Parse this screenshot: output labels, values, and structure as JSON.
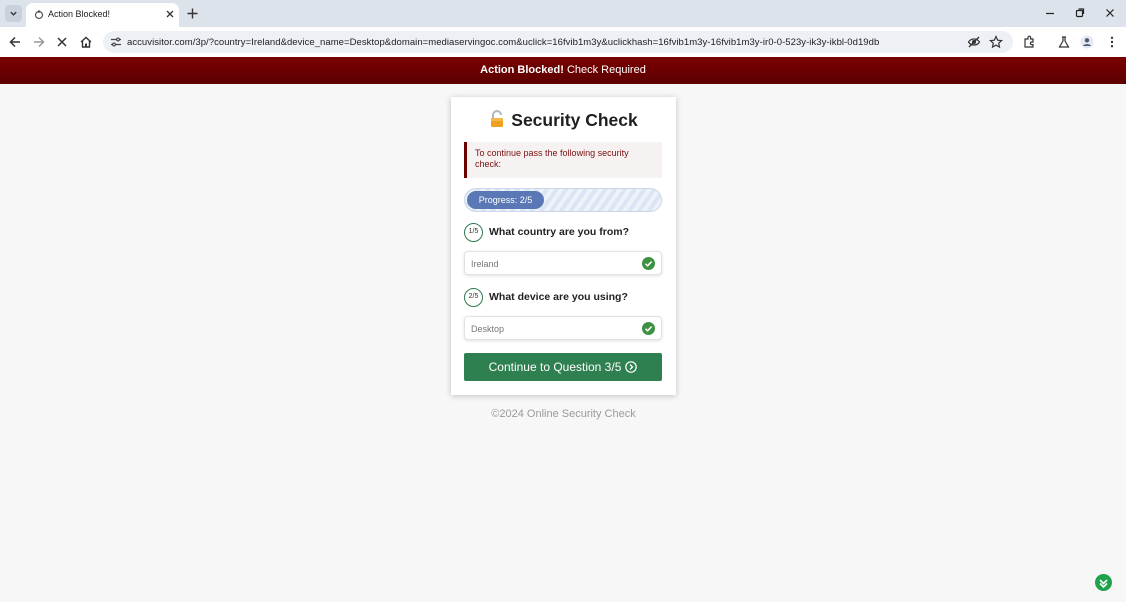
{
  "browser": {
    "tab_title": "Action Blocked!",
    "url_host": "accuvisitor.com",
    "url_rest": "/3p/?country=Ireland&device_name=Desktop&domain=mediaservingoc.com&uclick=16fvib1m3y&uclickhash=16fvib1m3y-16fvib1m3y-ir0-0-523y-ik3y-ikbl-0d19db"
  },
  "alert_bar": {
    "bold": "Action Blocked!",
    "text": " Check Required"
  },
  "card": {
    "title": "Security Check",
    "notice": "To continue pass the following security check:",
    "progress": {
      "label": "Progress: 2/5",
      "value": 0.4
    },
    "questions": [
      {
        "number": "1/5",
        "text": "What country are you from?",
        "answer": "Ireland"
      },
      {
        "number": "2/5",
        "text": "What device are you using?",
        "answer": "Desktop"
      }
    ],
    "continue_label": "Continue to Question 3/5"
  },
  "footer": "©2024 Online Security Check",
  "colors": {
    "alert_bar": "#6b0000",
    "button": "#2f8050",
    "progress_fill": "#5978b5",
    "check": "#3f9142"
  },
  "icons": [
    "tab-list-icon",
    "favicon-icon",
    "close-icon",
    "plus-icon",
    "minimize-icon",
    "restore-icon",
    "window-close-icon",
    "back-icon",
    "forward-icon",
    "stop-icon",
    "home-icon",
    "site-info-icon",
    "eye-off-icon",
    "star-icon",
    "extensions-icon",
    "labs-icon",
    "profile-icon",
    "menu-icon",
    "lock-icon",
    "check-icon",
    "arrow-circle-icon",
    "badge-icon"
  ]
}
